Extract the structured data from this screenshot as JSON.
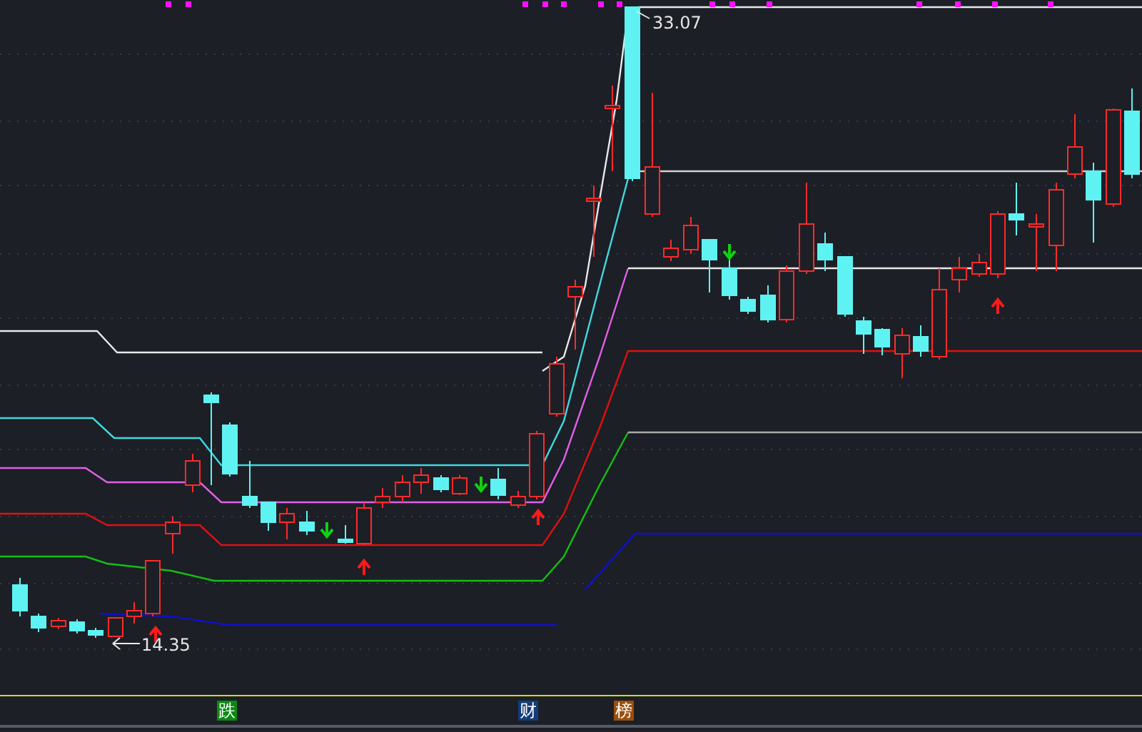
{
  "chart": {
    "high_label": "33.07",
    "low_label": "14.35"
  },
  "bottom_tags": [
    {
      "text": "跌",
      "color": "#0b8a12"
    },
    {
      "text": "财",
      "color": "#123d7a"
    },
    {
      "text": "榜",
      "color": "#9a4f0c"
    }
  ]
}
